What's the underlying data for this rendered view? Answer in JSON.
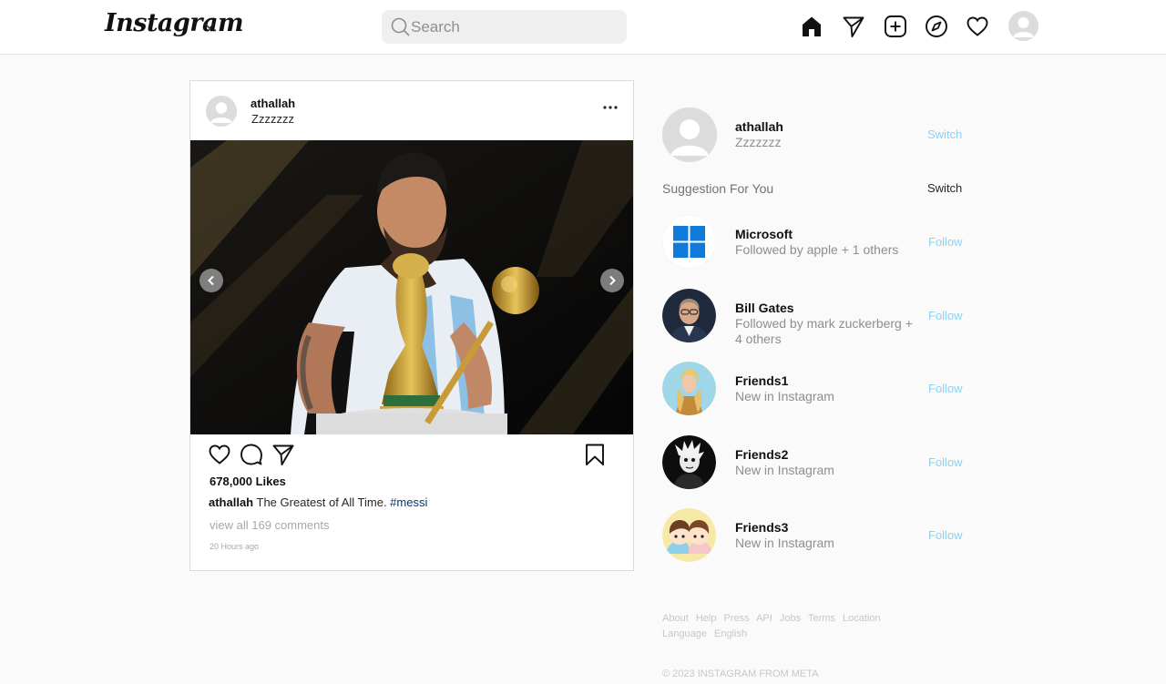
{
  "header": {
    "logo": "Instagram",
    "search_placeholder": "Search"
  },
  "post": {
    "username": "athallah",
    "location": "Zzzzzzz",
    "likes": "678,000 Likes",
    "caption_user": "athallah",
    "caption_text": " The Greatest of All Time. ",
    "caption_tag": "#messi",
    "comments_link": "view all 169 comments",
    "time": "20 Hours ago",
    "carousel_total": 2,
    "carousel_active": 1
  },
  "sidebar": {
    "me": {
      "username": "athallah",
      "subtitle": "Zzzzzzz",
      "action": "Switch"
    },
    "suggestions_title": "Suggestion For You",
    "suggestions_action": "Switch",
    "suggestions": [
      {
        "name": "Microsoft",
        "sub": "Followed by apple + 1 others",
        "action": "Follow"
      },
      {
        "name": "Bill Gates",
        "sub": "Followed by mark zuckerberg + 4 others",
        "action": "Follow"
      },
      {
        "name": "Friends1",
        "sub": "New in Instagram",
        "action": "Follow"
      },
      {
        "name": "Friends2",
        "sub": "New in Instagram",
        "action": "Follow"
      },
      {
        "name": "Friends3",
        "sub": "New in Instagram",
        "action": "Follow"
      }
    ]
  },
  "footer": {
    "links": [
      "About",
      "Help",
      "Press",
      "API",
      "Jobs",
      "Terms",
      "Location",
      "Language",
      "English"
    ],
    "copyright": "© 2023 INSTAGRAM FROM META"
  },
  "colors": {
    "link_blue": "#8ed2f2",
    "hashtag": "#00376b",
    "muted": "#8e8e8e"
  }
}
